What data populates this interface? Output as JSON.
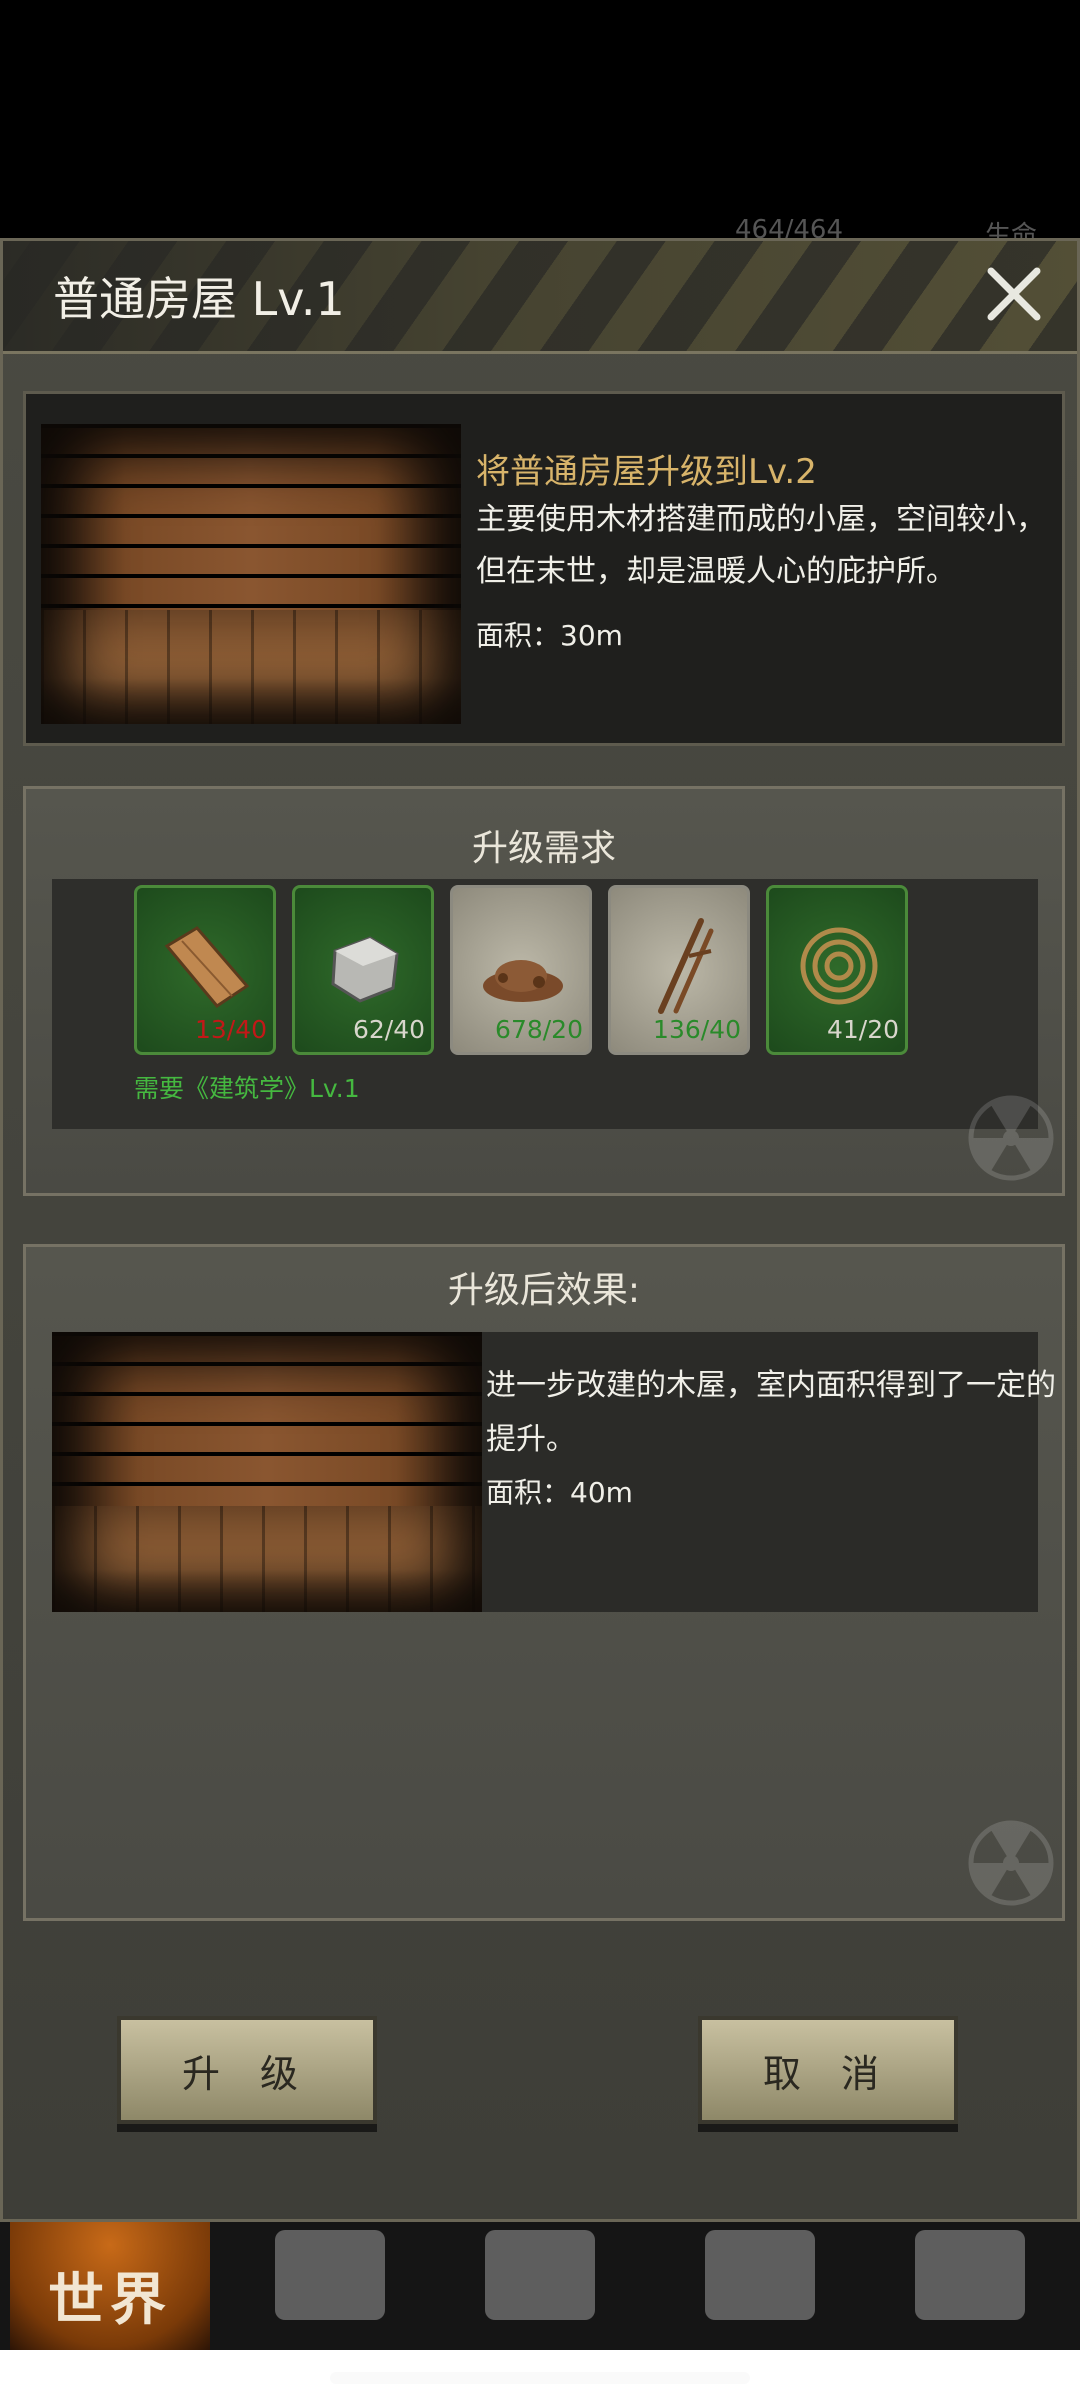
{
  "status_peek": {
    "hp": "464/464",
    "life_label": "生命"
  },
  "dialog": {
    "title": "普通房屋 Lv.1",
    "close_icon": "close-icon",
    "current": {
      "heading": "将普通房屋升级到Lv.2",
      "description": "主要使用木材搭建而成的小屋，空间较小，但在末世，却是温暖人心的庇护所。",
      "area": "面积：30m"
    },
    "requirements": {
      "heading": "升级需求",
      "items": [
        {
          "icon": "wood-plank-icon",
          "count": "13/40",
          "status": "insufficient"
        },
        {
          "icon": "stone-block-icon",
          "count": "62/40",
          "status": "ok"
        },
        {
          "icon": "dirt-pile-icon",
          "count": "678/20",
          "status": "ok"
        },
        {
          "icon": "twig-bundle-icon",
          "count": "136/40",
          "status": "ok"
        },
        {
          "icon": "rope-coil-icon",
          "count": "41/20",
          "status": "ok"
        }
      ],
      "note": "需要《建筑学》Lv.1"
    },
    "effect": {
      "heading": "升级后效果:",
      "description": "进一步改建的木屋，室内面积得到了一定的提升。",
      "area": "面积：40m"
    },
    "buttons": {
      "upgrade": "升 级",
      "cancel": "取 消"
    }
  },
  "bottom_nav": {
    "world": "世界",
    "icons": [
      "backpack-icon",
      "character-head-icon",
      "calculator-icon",
      "cart-icon"
    ]
  },
  "colors": {
    "accent_gold": "#d8b46a",
    "ok_green": "#2a8a2a",
    "bad_red": "#c21818",
    "note_green": "#45b840"
  }
}
